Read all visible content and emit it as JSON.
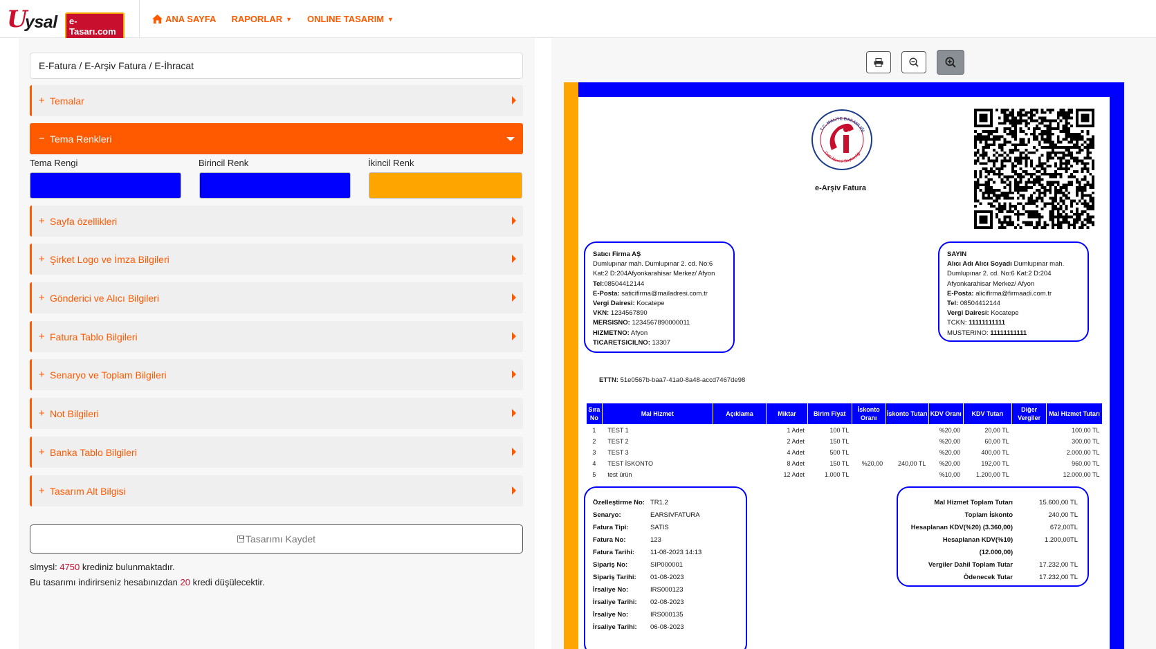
{
  "app": {
    "logo_text": "Uysal",
    "logo_badge": "e-Tasarı.com"
  },
  "nav": {
    "home": "ANA SAYFA",
    "reports": "RAPORLAR",
    "online_design": "ONLINE TASARIM"
  },
  "left": {
    "breadcrumb": "E-Fatura / E-Arşiv Fatura / E-İhracat",
    "sections": [
      {
        "label": "Temalar",
        "sign": "+"
      },
      {
        "label": "Tema Renkleri",
        "sign": "−"
      },
      {
        "label": "Sayfa özellikleri",
        "sign": "+"
      },
      {
        "label": "Şirket Logo ve İmza Bilgileri",
        "sign": "+"
      },
      {
        "label": "Gönderici ve Alıcı Bilgileri",
        "sign": "+"
      },
      {
        "label": "Fatura Tablo Bilgileri",
        "sign": "+"
      },
      {
        "label": "Senaryo ve Toplam Bilgileri",
        "sign": "+"
      },
      {
        "label": "Not Bilgileri",
        "sign": "+"
      },
      {
        "label": "Banka Tablo Bilgileri",
        "sign": "+"
      },
      {
        "label": "Tasarım Alt Bilgisi",
        "sign": "+"
      }
    ],
    "colors": {
      "theme_label": "Tema Rengi",
      "theme_value": "#0000ff",
      "primary_label": "Birincil Renk",
      "primary_value": "#0000ff",
      "secondary_label": "İkincil Renk",
      "secondary_value": "#ffa500"
    },
    "save_label": "Tasarımı Kaydet",
    "credit": {
      "user": "slmysl:",
      "amount": "4750",
      "text": "krediniz bulunmaktadır.",
      "line2_pre": "Bu tasarımı indirirseniz hesabınızdan",
      "deduct": "20",
      "line2_post": "kredi düşülecektir."
    }
  },
  "toolbar": {
    "print_icon": "print-icon",
    "zoom_out_icon": "zoom-out-icon",
    "zoom_in_icon": "zoom-in-icon"
  },
  "invoice": {
    "seal_top": "T.C. MALİYE BAKANLIĞI",
    "seal_bottom": "Gelir İdaresi Başkanlığı",
    "title": "e-Arşiv Fatura",
    "seller": {
      "name": "Satıcı Firma AŞ",
      "addr1": "Dumlupınar mah. Dumlupınar 2. cd. No:6",
      "addr2": "Kat:2 D:204Afyonkarahisar Merkez/ Afyon",
      "tel_label": "Tel:",
      "tel": "08504412144",
      "email_label": "E-Posta:",
      "email": "saticifirma@mailadresi.com.tr",
      "tax_office_label": "Vergi Dairesi:",
      "tax_office": "Kocatepe",
      "vkn_label": "VKN:",
      "vkn": "1234567890",
      "mersis_label": "MERSISNO:",
      "mersis": "1234567890000011",
      "hizmet_label": "HIZMETNO:",
      "hizmet": "Afyon",
      "ticaret_label": "TICARETSICILNO:",
      "ticaret": "13307"
    },
    "buyer": {
      "heading": "SAYIN",
      "name_label": "Alıcı Adı Alıcı Soyadı",
      "addr1": "Dumlupınar mah.",
      "addr2": "Dumlupınar 2. cd. No:6 Kat:2 D:204",
      "addr3": "Afyonkarahisar Merkez/ Afyon",
      "email_label": "E-Posta:",
      "email": "alicifirma@firmaadi.com.tr",
      "tel_label": "Tel:",
      "tel": "08504412144",
      "tax_office_label": "Vergi Dairesi:",
      "tax_office": "Kocatepe",
      "tckn_label": "TCKN:",
      "tckn": "11111111111",
      "musteri_label": "MUSTERINO:",
      "musteri": "11111111111"
    },
    "ettn_label": "ETTN:",
    "ettn": "51e0567b-baa7-41a0-8a48-accd7467de98",
    "table": {
      "headers": [
        "Sıra No",
        "Mal Hizmet",
        "Açıklama",
        "Miktar",
        "Birim Fiyat",
        "İskonto Oranı",
        "İskonto Tutarı",
        "KDV Oranı",
        "KDV Tutarı",
        "Diğer Vergiler",
        "Mal Hizmet Tutarı"
      ],
      "rows": [
        [
          "1",
          "TEST 1",
          "",
          "1 Adet",
          "100 TL",
          "",
          "",
          "%20,00",
          "20,00 TL",
          "",
          "100,00 TL"
        ],
        [
          "2",
          "TEST 2",
          "",
          "2 Adet",
          "150 TL",
          "",
          "",
          "%20,00",
          "60,00 TL",
          "",
          "300,00 TL"
        ],
        [
          "3",
          "TEST 3",
          "",
          "4 Adet",
          "500 TL",
          "",
          "",
          "%20,00",
          "400,00 TL",
          "",
          "2.000,00 TL"
        ],
        [
          "4",
          "TEST İSKONTO",
          "",
          "8 Adet",
          "150 TL",
          "%20,00",
          "240,00 TL",
          "%20,00",
          "192,00 TL",
          "",
          "960,00 TL"
        ],
        [
          "5",
          "test ürün",
          "",
          "12 Adet",
          "1.000 TL",
          "",
          "",
          "%10,00",
          "1.200,00 TL",
          "",
          "12.000,00 TL"
        ]
      ]
    },
    "scenario": [
      {
        "k": "Özelleştirme No:",
        "v": "TR1.2"
      },
      {
        "k": "Senaryo:",
        "v": "EARSIVFATURA"
      },
      {
        "k": "Fatura Tipi:",
        "v": "SATIS"
      },
      {
        "k": "Fatura No:",
        "v": "123"
      },
      {
        "k": "Fatura Tarihi:",
        "v": "11-08-2023 14:13"
      },
      {
        "k": "Sipariş No:",
        "v": "SIP000001"
      },
      {
        "k": "Sipariş Tarihi:",
        "v": "01-08-2023"
      },
      {
        "k": "İrsaliye No:",
        "v": "IRS000123"
      },
      {
        "k": "İrsaliye Tarihi:",
        "v": "02-08-2023"
      },
      {
        "k": "İrsaliye No:",
        "v": "IRS000135"
      },
      {
        "k": "İrsaliye Tarihi:",
        "v": "06-08-2023"
      }
    ],
    "totals": [
      {
        "k": "Mal Hizmet Toplam Tutarı",
        "v": "15.600,00 TL"
      },
      {
        "k": "Toplam İskonto",
        "v": "240,00 TL"
      },
      {
        "k": "Hesaplanan KDV(%20) (3.360,00)",
        "v": "672,00TL"
      },
      {
        "k": "Hesaplanan KDV(%10) (12.000,00)",
        "v": "1.200,00TL"
      },
      {
        "k": "Vergiler Dahil Toplam Tutar",
        "v": "17.232,00 TL"
      },
      {
        "k": "Ödenecek Tutar",
        "v": "17.232,00 TL"
      }
    ]
  }
}
